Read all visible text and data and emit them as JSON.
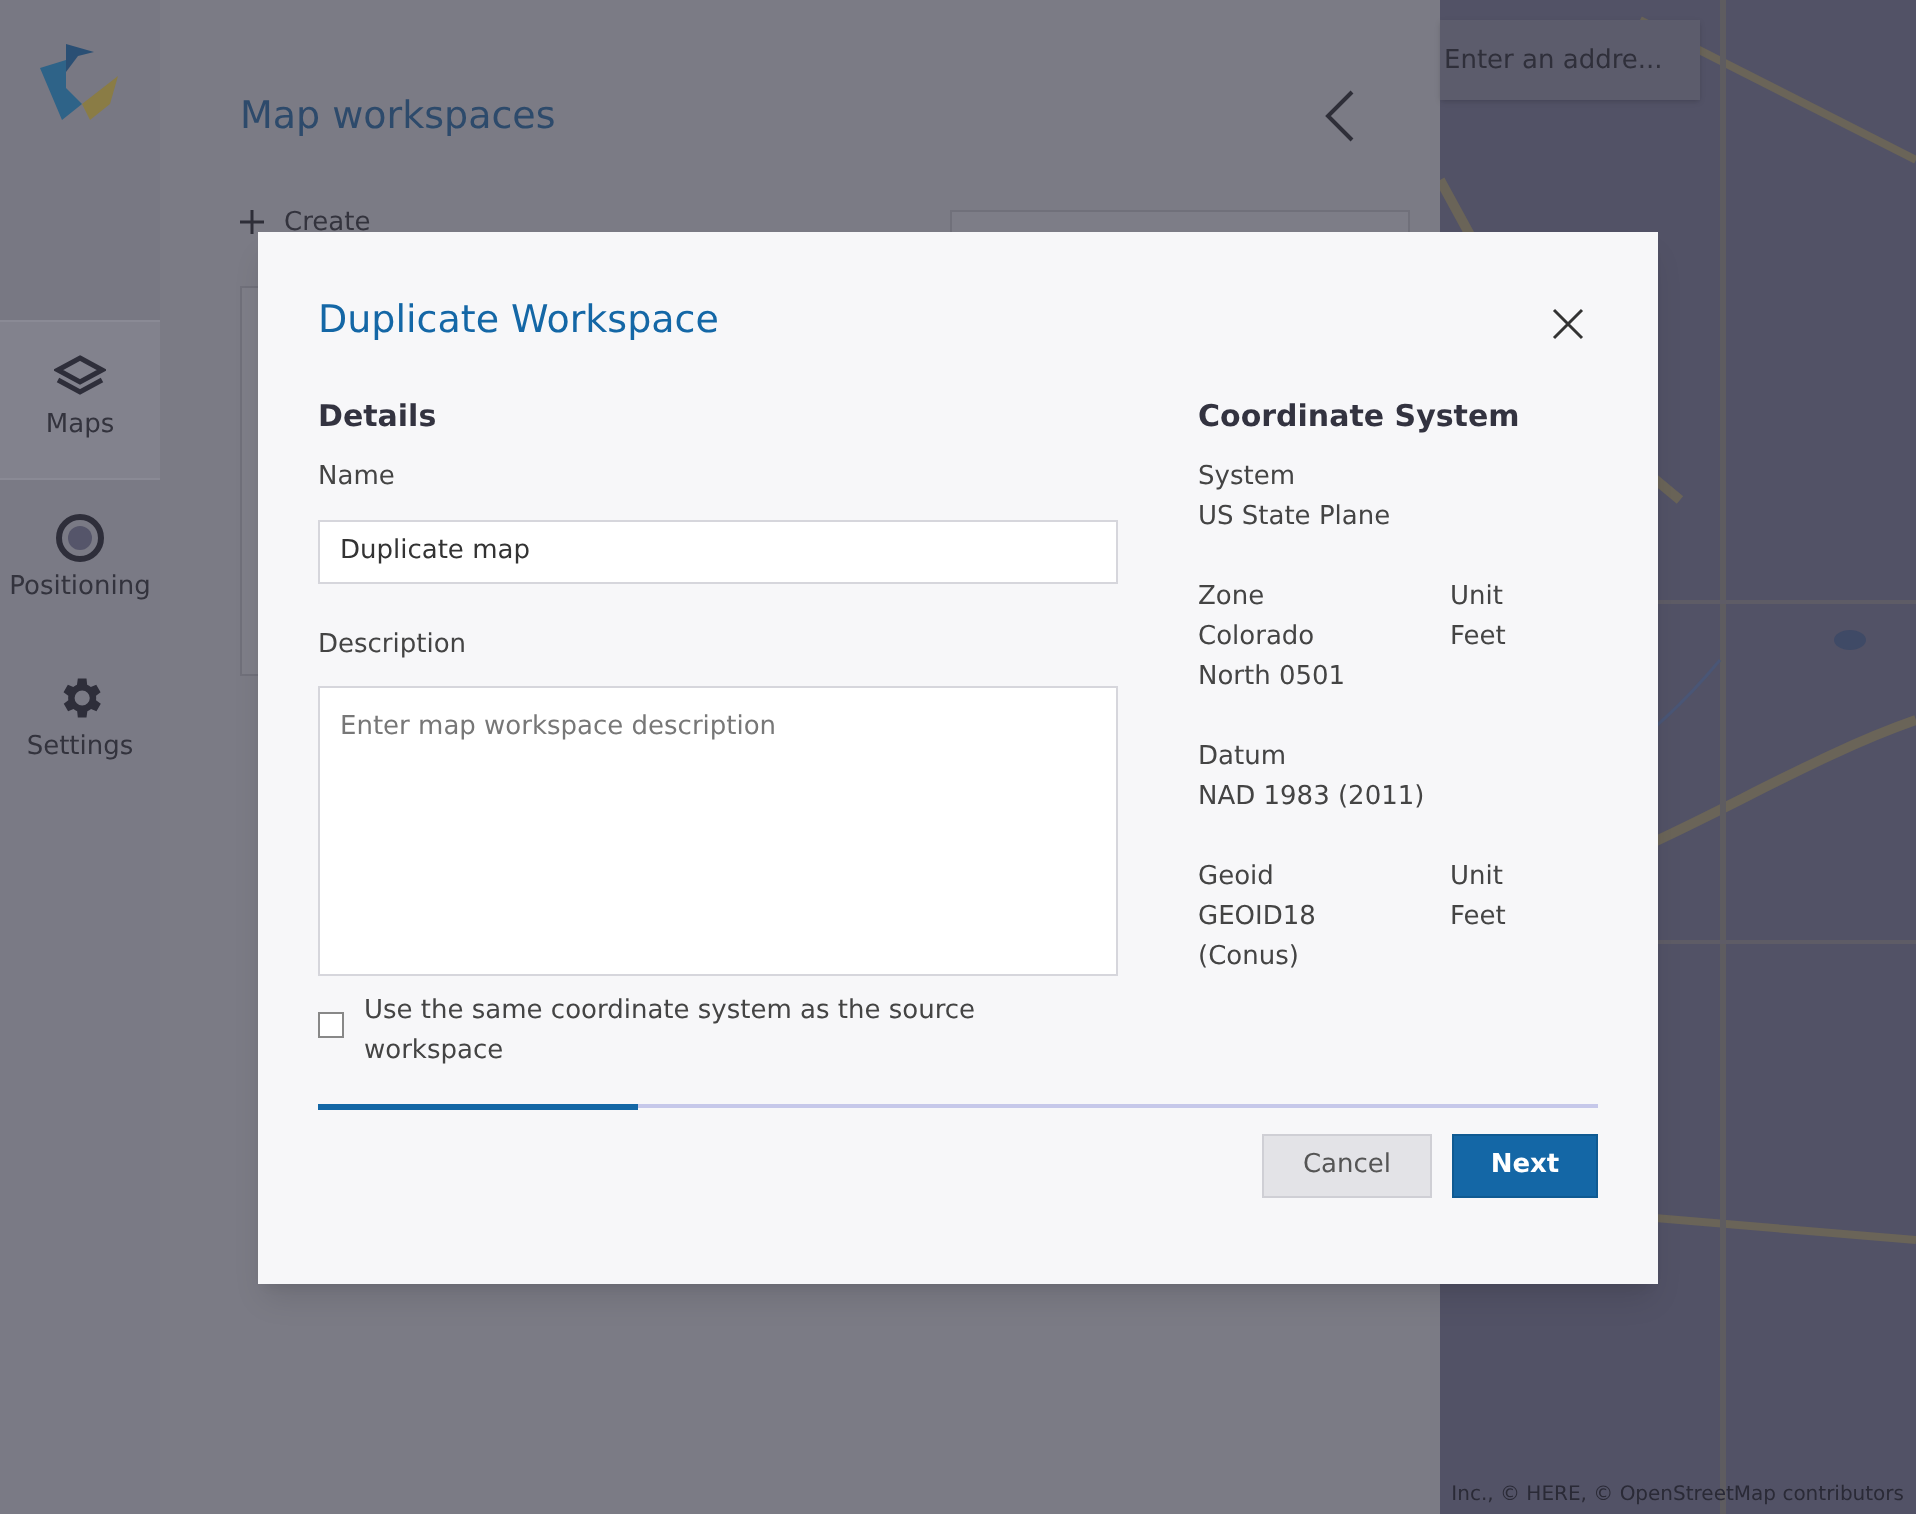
{
  "sidebar": {
    "items": [
      {
        "label": "Maps",
        "kind": "layers",
        "selected": true
      },
      {
        "label": "Positioning",
        "kind": "target",
        "selected": false
      },
      {
        "label": "Settings",
        "kind": "gear",
        "selected": false
      }
    ]
  },
  "panel": {
    "title": "Map workspaces",
    "create_label": "Create"
  },
  "map": {
    "search": {
      "placeholder": "Enter an addre..."
    },
    "attribution": "Inc., © HERE, © OpenStreetMap contributors"
  },
  "dialog": {
    "title": "Duplicate Workspace",
    "details": {
      "heading": "Details",
      "name_label": "Name",
      "name_value": "Duplicate map",
      "description_label": "Description",
      "description_placeholder": "Enter map workspace description",
      "checkbox": {
        "label": "Use the same coordinate system as the source workspace",
        "checked": false
      }
    },
    "coordinate_system": {
      "heading": "Coordinate System",
      "groups": [
        {
          "label": "System",
          "lines": [
            "US State Plane"
          ]
        },
        {
          "label": "Zone",
          "lines": [
            "Colorado",
            "North 0501"
          ],
          "unit_label": "Unit",
          "unit": "Feet"
        },
        {
          "label": "Datum",
          "lines": [
            "NAD 1983 (2011)"
          ]
        },
        {
          "label": "Geoid",
          "lines": [
            "GEOID18",
            "(Conus)"
          ],
          "unit_label": "Unit",
          "unit": "Feet"
        }
      ]
    },
    "progress": {
      "level": 0.25
    },
    "buttons": [
      {
        "label": "Cancel",
        "kind": "secondary"
      },
      {
        "label": "Next",
        "kind": "primary"
      }
    ]
  }
}
